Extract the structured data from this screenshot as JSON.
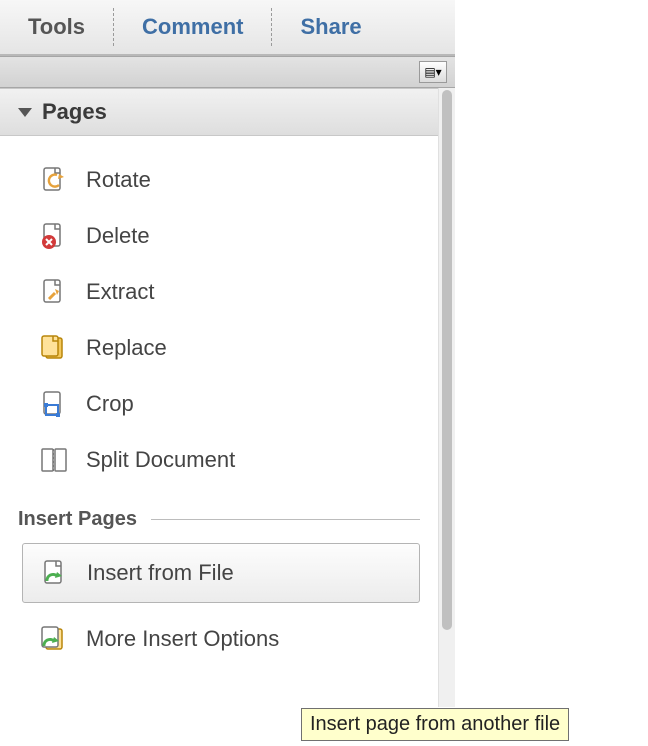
{
  "tabs": {
    "tools": "Tools",
    "comment": "Comment",
    "share": "Share"
  },
  "section": {
    "pages_title": "Pages",
    "items": {
      "rotate": "Rotate",
      "delete": "Delete",
      "extract": "Extract",
      "replace": "Replace",
      "crop": "Crop",
      "split": "Split Document"
    }
  },
  "insert_pages": {
    "title": "Insert Pages",
    "items": {
      "from_file": "Insert from File",
      "more_options": "More Insert Options"
    }
  },
  "tooltip": "Insert page from another file"
}
